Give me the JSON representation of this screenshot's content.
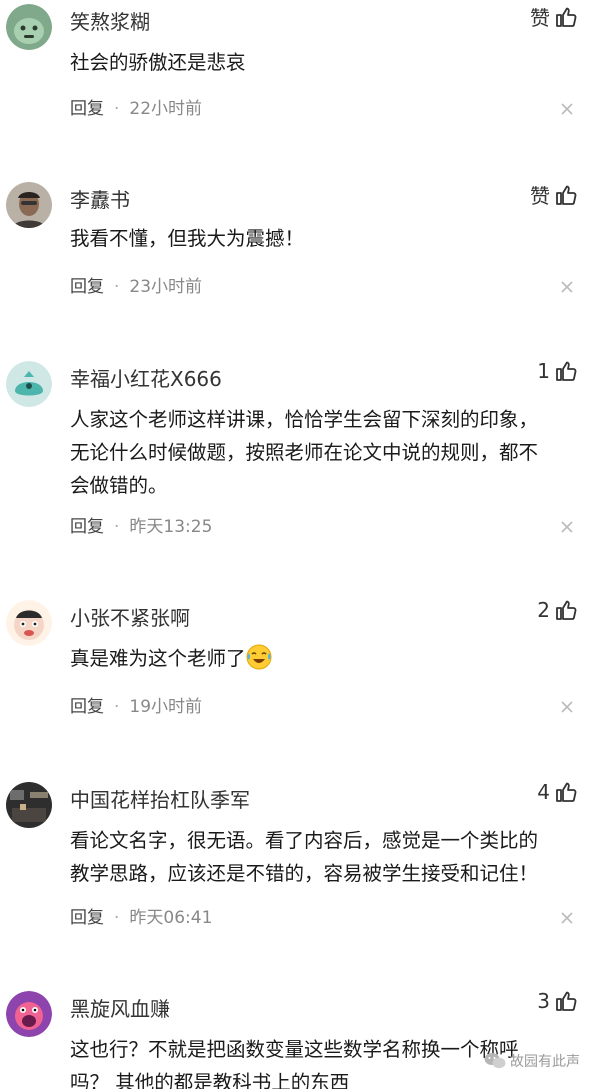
{
  "comments": [
    {
      "name": "笑熬浆糊",
      "like_label": "赞",
      "lines": [
        "社会的骄傲还是悲哀"
      ],
      "reply_label": "回复",
      "time": "22小时前",
      "avatar_color": "#7fa98a"
    },
    {
      "name": "李纛书",
      "like_label": "赞",
      "lines": [
        "我看不懂，但我大为震撼！"
      ],
      "reply_label": "回复",
      "time": "23小时前",
      "avatar_color": "#6a5a4c"
    },
    {
      "name": "幸福小红花X666",
      "like_label": "1",
      "lines": [
        "人家这个老师这样讲课，恰恰学生会留下深刻的印象，",
        "无论什么时候做题，按照老师在论文中说的规则，都不",
        "会做错的。"
      ],
      "reply_label": "回复",
      "time": "昨天13:25",
      "avatar_color": "#4db6ac"
    },
    {
      "name": "小张不紧张啊",
      "like_label": "2",
      "lines": [
        "真是难为这个老师了"
      ],
      "reply_label": "回复",
      "time": "19小时前",
      "avatar_color": "#f5d6c6"
    },
    {
      "name": "中国花样抬杠队季军",
      "like_label": "4",
      "lines": [
        "看论文名字，很无语。看了内容后，感觉是一个类比的",
        "教学思路，应该还是不错的，容易被学生接受和记住！"
      ],
      "reply_label": "回复",
      "time": "昨天06:41",
      "avatar_color": "#3a3a3a"
    },
    {
      "name": "黑旋风血赚",
      "like_label": "3",
      "lines": [
        "这也行？不就是把函数变量这些数学名称换一个称呼",
        "吗？ 其他的都是教科书上的东西"
      ],
      "reply_label": "",
      "time": "",
      "avatar_color": "#8e44ad"
    }
  ],
  "watermark": "故园有此声"
}
